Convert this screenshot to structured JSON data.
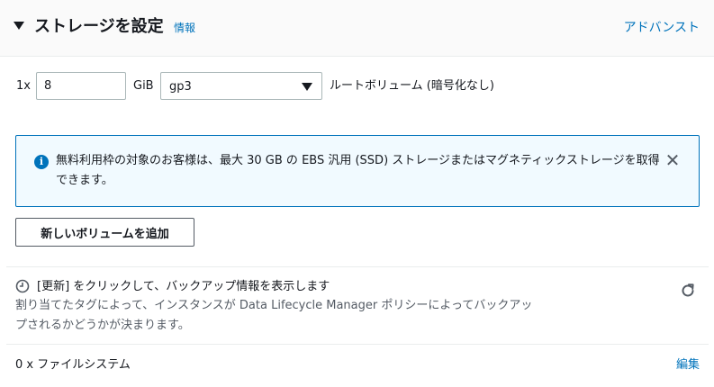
{
  "header": {
    "title": "ストレージを設定",
    "info_link": "情報",
    "advanced_link": "アドバンスト"
  },
  "volume": {
    "multiplier": "1x",
    "size_value": "8",
    "unit": "GiB",
    "type_selected": "gp3",
    "description": "ルートボリューム (暗号化なし)"
  },
  "alert": {
    "text": "無料利用枠の対象のお客様は、最大 30 GB の EBS 汎用 (SSD) ストレージまたはマグネティックストレージを取得できます。",
    "close_glyph": "✕"
  },
  "add_volume_button": "新しいボリュームを追加",
  "backup": {
    "title": "[更新] をクリックして、バックアップ情報を表示します",
    "description": "割り当てたタグによって、インスタンスが Data Lifecycle Manager ポリシーによってバックアップされるかどうかが決まります。"
  },
  "filesystem": {
    "label": "0 x ファイルシステム",
    "edit_link": "編集"
  },
  "colors": {
    "accent": "#0073bb",
    "alert_bg": "#f1faff",
    "text": "#16191f"
  }
}
